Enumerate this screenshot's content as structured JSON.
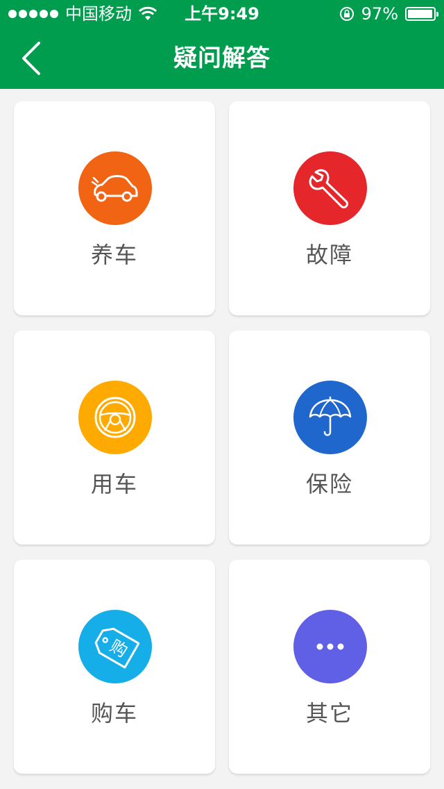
{
  "status_bar": {
    "carrier": "中国移动",
    "time": "上午9:49",
    "battery_text": "97%",
    "battery_level": 0.97
  },
  "nav": {
    "title": "疑问解答",
    "back_icon": "chevron-left-icon"
  },
  "colors": {
    "header": "#009d4f",
    "background": "#f3f3f3"
  },
  "categories": [
    {
      "label": "养车",
      "icon": "car-icon",
      "color": "#f06414"
    },
    {
      "label": "故障",
      "icon": "wrench-icon",
      "color": "#e5262b"
    },
    {
      "label": "用车",
      "icon": "steering-wheel-icon",
      "color": "#ffaa00"
    },
    {
      "label": "保险",
      "icon": "umbrella-icon",
      "color": "#1f67cc"
    },
    {
      "label": "购车",
      "icon": "tag-icon",
      "color": "#16aee9",
      "icon_text": "购"
    },
    {
      "label": "其它",
      "icon": "more-icon",
      "color": "#6060e6"
    }
  ]
}
